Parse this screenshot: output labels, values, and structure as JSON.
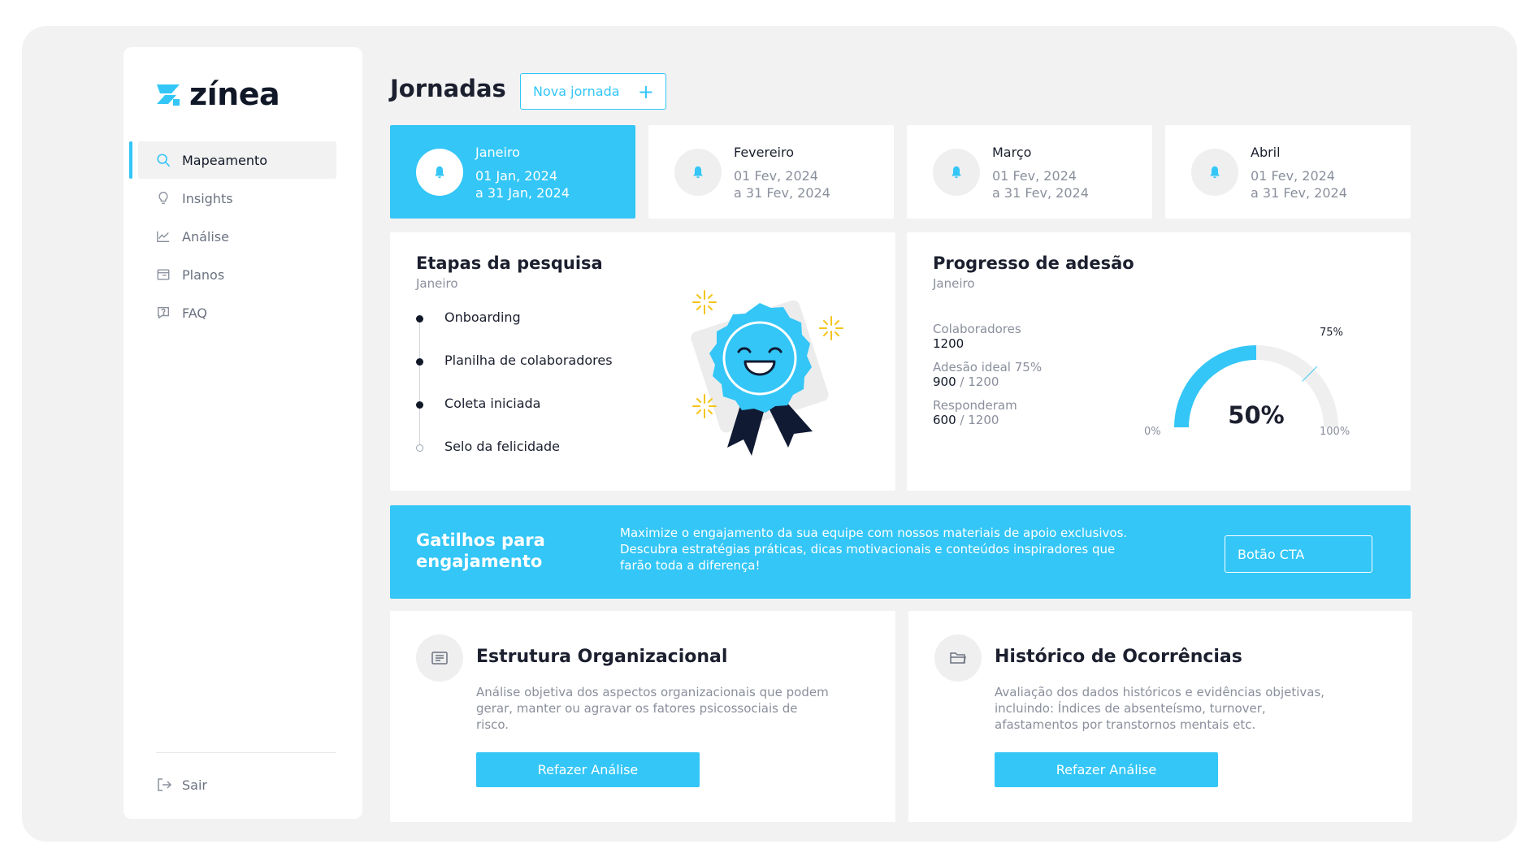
{
  "brand": {
    "name": "zínea",
    "accent": "#33c6f7"
  },
  "sidebar": {
    "items": [
      {
        "label": "Mapeamento",
        "icon": "search-icon",
        "active": true
      },
      {
        "label": "Insights",
        "icon": "lightbulb-icon",
        "active": false
      },
      {
        "label": "Análise",
        "icon": "line-chart-icon",
        "active": false
      },
      {
        "label": "Planos",
        "icon": "calendar-icon",
        "active": false
      },
      {
        "label": "FAQ",
        "icon": "help-icon",
        "active": false
      }
    ],
    "logout_label": "Sair"
  },
  "header": {
    "title": "Jornadas",
    "new_journey_label": "Nova jornada",
    "new_journey_icon": "plus-icon"
  },
  "months": [
    {
      "name": "Janeiro",
      "start": "01 Jan, 2024",
      "end": "a 31 Jan, 2024",
      "active": true
    },
    {
      "name": "Fevereiro",
      "start": "01 Fev, 2024",
      "end": "a 31 Fev, 2024",
      "active": false
    },
    {
      "name": "Março",
      "start": "01 Fev, 2024",
      "end": "a 31 Fev, 2024",
      "active": false
    },
    {
      "name": "Abril",
      "start": "01 Fev, 2024",
      "end": "a 31 Fev, 2024",
      "active": false
    }
  ],
  "steps_card": {
    "title": "Etapas da pesquisa",
    "subtitle": "Janeiro",
    "steps": [
      {
        "label": "Onboarding",
        "done": true
      },
      {
        "label": "Planilha de colaboradores",
        "done": true
      },
      {
        "label": "Coleta iniciada",
        "done": true
      },
      {
        "label": "Selo da felicidade",
        "done": false
      }
    ]
  },
  "progress_card": {
    "title": "Progresso de adesão",
    "subtitle": "Janeiro",
    "stats": [
      {
        "label": "Colaboradores",
        "value": "1200",
        "total": ""
      },
      {
        "label": "Adesão ideal 75%",
        "value": "900",
        "total": " / 1200"
      },
      {
        "label": "Responderam",
        "value": "600",
        "total": " / 1200"
      }
    ],
    "gauge": {
      "value_label": "50%",
      "value": 0.5,
      "target": 0.75,
      "target_label": "75%",
      "min_label": "0%",
      "max_label": "100%"
    }
  },
  "cta": {
    "title": "Gatilhos para engajamento",
    "text": "Maximize o engajamento da sua equipe com nossos materiais de apoio exclusivos. Descubra estratégias práticas, dicas motivacionais e conteúdos inspiradores que farão toda a diferença!",
    "button_label": "Botão CTA"
  },
  "features": [
    {
      "icon": "list-icon",
      "title": "Estrutura Organizacional",
      "description": "Análise objetiva dos aspectos organizacionais que podem gerar, manter ou agravar os fatores psicossociais de risco.",
      "button_label": "Refazer Análise"
    },
    {
      "icon": "folder-icon",
      "title": "Histórico de Ocorrências",
      "description": "Avaliação dos dados históricos e evidências objetivas, incluindo: Índices de absenteísmo, turnover, afastamentos por transtornos mentais etc.",
      "button_label": "Refazer Análise"
    }
  ]
}
